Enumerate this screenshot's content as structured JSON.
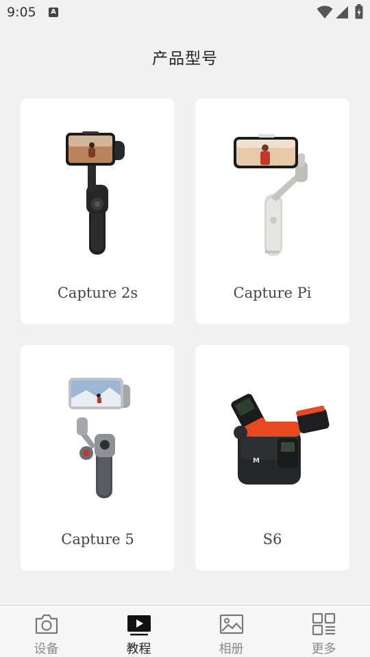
{
  "status_bar": {
    "time": "9:05",
    "badge": "A"
  },
  "page_title": "产品型号",
  "products": [
    {
      "name": "Capture 2s"
    },
    {
      "name": "Capture Pi"
    },
    {
      "name": "Capture 5"
    },
    {
      "name": "S6"
    }
  ],
  "bottom_nav": {
    "items": [
      {
        "label": "设备",
        "icon": "camera-icon",
        "active": false
      },
      {
        "label": "教程",
        "icon": "play-icon",
        "active": true
      },
      {
        "label": "相册",
        "icon": "image-icon",
        "active": false
      },
      {
        "label": "更多",
        "icon": "more-grid-icon",
        "active": false
      }
    ]
  }
}
